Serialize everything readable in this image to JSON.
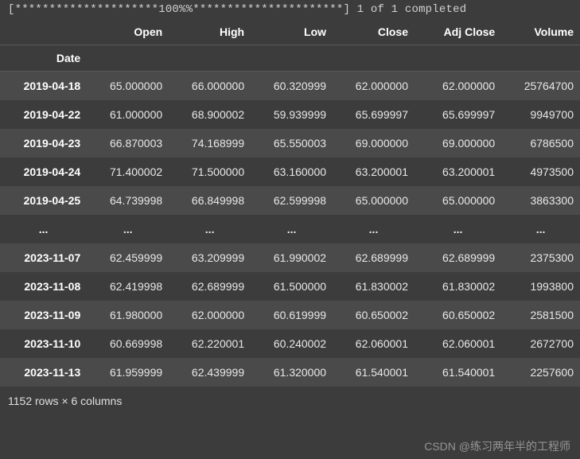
{
  "progress_line": "[*********************100%%**********************]  1 of 1 completed",
  "columns": [
    "Open",
    "High",
    "Low",
    "Close",
    "Adj Close",
    "Volume"
  ],
  "index_name": "Date",
  "rows_top": [
    {
      "date": "2019-04-18",
      "open": "65.000000",
      "high": "66.000000",
      "low": "60.320999",
      "close": "62.000000",
      "adj": "62.000000",
      "volume": "25764700"
    },
    {
      "date": "2019-04-22",
      "open": "61.000000",
      "high": "68.900002",
      "low": "59.939999",
      "close": "65.699997",
      "adj": "65.699997",
      "volume": "9949700"
    },
    {
      "date": "2019-04-23",
      "open": "66.870003",
      "high": "74.168999",
      "low": "65.550003",
      "close": "69.000000",
      "adj": "69.000000",
      "volume": "6786500"
    },
    {
      "date": "2019-04-24",
      "open": "71.400002",
      "high": "71.500000",
      "low": "63.160000",
      "close": "63.200001",
      "adj": "63.200001",
      "volume": "4973500"
    },
    {
      "date": "2019-04-25",
      "open": "64.739998",
      "high": "66.849998",
      "low": "62.599998",
      "close": "65.000000",
      "adj": "65.000000",
      "volume": "3863300"
    }
  ],
  "ellipsis": "...",
  "rows_bottom": [
    {
      "date": "2023-11-07",
      "open": "62.459999",
      "high": "63.209999",
      "low": "61.990002",
      "close": "62.689999",
      "adj": "62.689999",
      "volume": "2375300"
    },
    {
      "date": "2023-11-08",
      "open": "62.419998",
      "high": "62.689999",
      "low": "61.500000",
      "close": "61.830002",
      "adj": "61.830002",
      "volume": "1993800"
    },
    {
      "date": "2023-11-09",
      "open": "61.980000",
      "high": "62.000000",
      "low": "60.619999",
      "close": "60.650002",
      "adj": "60.650002",
      "volume": "2581500"
    },
    {
      "date": "2023-11-10",
      "open": "60.669998",
      "high": "62.220001",
      "low": "60.240002",
      "close": "62.060001",
      "adj": "62.060001",
      "volume": "2672700"
    },
    {
      "date": "2023-11-13",
      "open": "61.959999",
      "high": "62.439999",
      "low": "61.320000",
      "close": "61.540001",
      "adj": "61.540001",
      "volume": "2257600"
    }
  ],
  "shape_text": "1152 rows × 6 columns",
  "watermark": "CSDN @练习两年半的工程师"
}
